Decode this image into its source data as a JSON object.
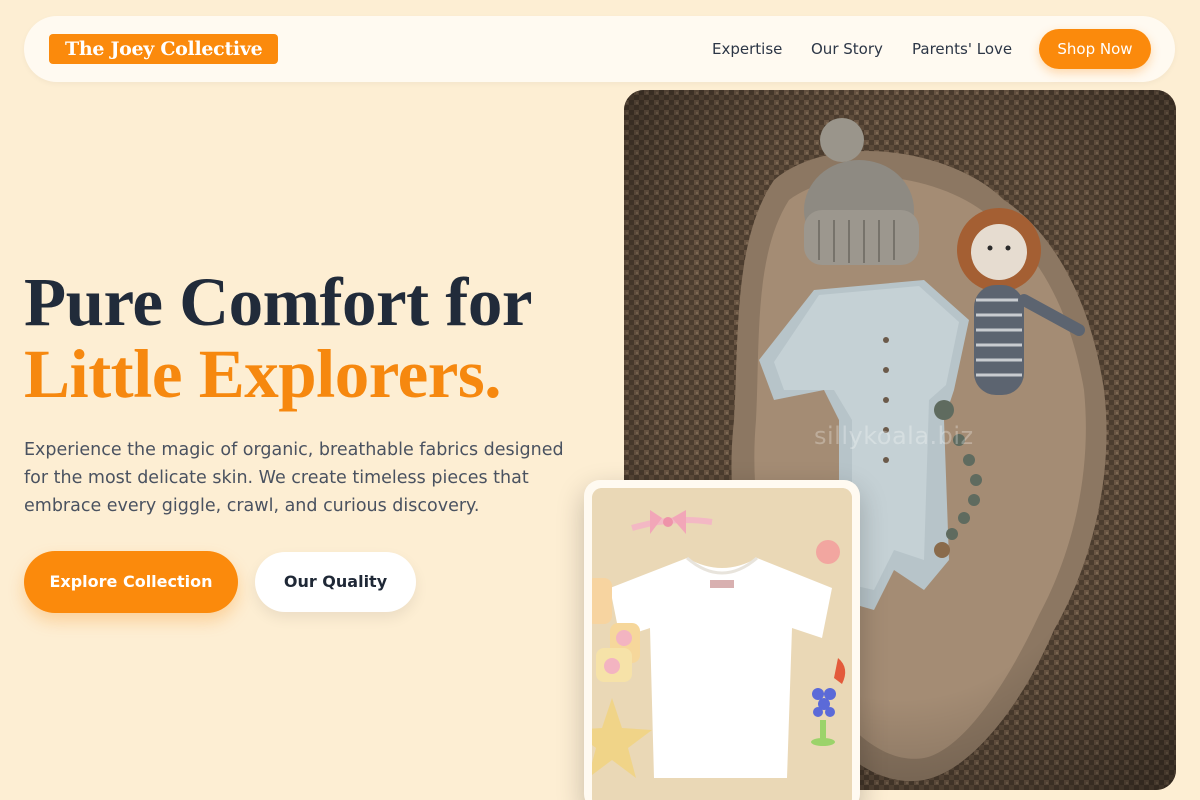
{
  "brand": {
    "name": "The Joey Collective"
  },
  "nav": {
    "links": [
      "Expertise",
      "Our Story",
      "Parents' Love"
    ],
    "cta": "Shop Now"
  },
  "hero": {
    "headline_line1": "Pure Comfort for",
    "headline_line2": "Little Explorers.",
    "description": "Experience the magic of organic, breathable fabrics designed for the most delicate skin. We create timeless pieces that embrace every giggle, crawl, and curious discovery.",
    "primary_button": "Explore Collection",
    "secondary_button": "Our Quality"
  },
  "images": {
    "main_watermark": "sillykoala.biz"
  },
  "colors": {
    "accent": "#fb8a0c",
    "background": "#fdeed3",
    "text": "#212b3a"
  }
}
